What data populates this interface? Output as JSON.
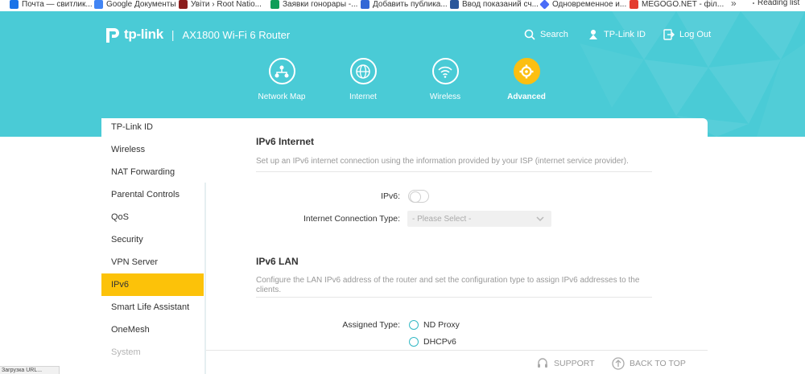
{
  "bookmarks": [
    {
      "label": "Почта — свитлик...",
      "icon": "mail-icon",
      "color": "#1a73e8"
    },
    {
      "label": "Google Документы",
      "icon": "google-docs-icon",
      "color": "#4285f4"
    },
    {
      "label": "Увіти › Root Natio...",
      "icon": "site-icon",
      "color": "#8b1e1e"
    },
    {
      "label": "Заявки гонорары -...",
      "icon": "sheet-icon",
      "color": "#0f9d58"
    },
    {
      "label": "Добавить публика...",
      "icon": "page-icon",
      "color": "#3367d6"
    },
    {
      "label": "Ввод показаний сч...",
      "icon": "meter-icon",
      "color": "#2b579a"
    },
    {
      "label": "Одновременное и...",
      "icon": "diamond-icon",
      "color": "#4a6cf7"
    },
    {
      "label": "MEGOGO.NET - філ...",
      "icon": "megogo-icon",
      "color": "#e43d30"
    }
  ],
  "bookmarks_more": "»",
  "reading_list": "Reading list",
  "header": {
    "brand": "tp-link",
    "model": "AX1800 Wi-Fi 6 Router",
    "search": "Search",
    "tplink_id": "TP-Link ID",
    "logout": "Log Out"
  },
  "nav": [
    {
      "label": "Network Map",
      "icon": "network-map-icon"
    },
    {
      "label": "Internet",
      "icon": "globe-icon"
    },
    {
      "label": "Wireless",
      "icon": "wifi-icon"
    },
    {
      "label": "Advanced",
      "icon": "gear-icon",
      "active": true
    }
  ],
  "sidebar": [
    {
      "label": "TP-Link ID"
    },
    {
      "label": "Wireless"
    },
    {
      "label": "NAT Forwarding"
    },
    {
      "label": "Parental Controls"
    },
    {
      "label": "QoS"
    },
    {
      "label": "Security"
    },
    {
      "label": "VPN Server"
    },
    {
      "label": "IPv6",
      "active": true
    },
    {
      "label": "Smart Life Assistant"
    },
    {
      "label": "OneMesh"
    },
    {
      "label": "System",
      "disabled": true
    }
  ],
  "ipv6_internet": {
    "title": "IPv6 Internet",
    "description": "Set up an IPv6 internet connection using the information provided by your ISP (internet service provider).",
    "ipv6_label": "IPv6:",
    "ipv6_enabled": false,
    "conn_type_label": "Internet Connection Type:",
    "conn_type_value": "- Please Select -"
  },
  "ipv6_lan": {
    "title": "IPv6 LAN",
    "description": "Configure the LAN IPv6 address of the router and set the configuration type to assign IPv6 addresses to the clients.",
    "assigned_type_label": "Assigned Type:",
    "options": [
      "ND Proxy",
      "DHCPv6"
    ]
  },
  "footer": {
    "support": "SUPPORT",
    "back_to_top": "BACK TO TOP"
  },
  "status_text": "Загрузка URL...",
  "colors": {
    "header_bg": "#4acbd6",
    "accent": "#fcbf11",
    "radio_border": "#34b9c5"
  }
}
